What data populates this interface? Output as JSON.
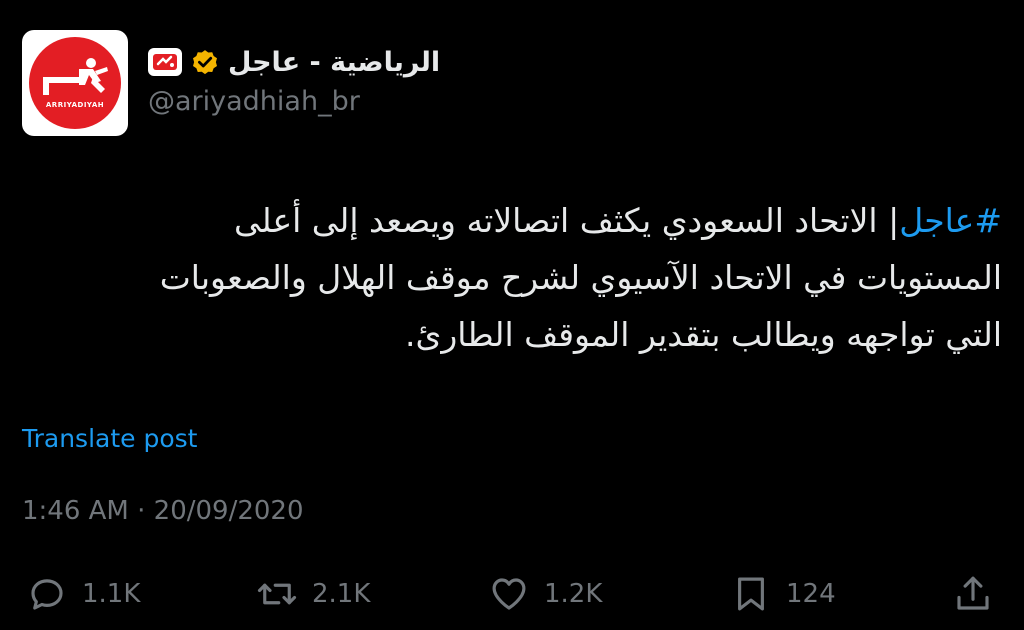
{
  "author": {
    "display_name": "الرياضية - عاجل",
    "handle": "@ariyadhiah_br",
    "avatar_logo_text": "ARRIYADIYAH",
    "affiliate_badge_text": "ر",
    "verified": true,
    "brand_color": "#e31e24",
    "verified_color": "#f4b400"
  },
  "tweet": {
    "hashtag": "#عاجل",
    "lines": [
      "| الاتحاد السعودي يكثف اتصالاته ويصعد إلى أعلى",
      "المستويات في الاتحاد الآسيوي لشرح موقف الهلال والصعوبات",
      "التي تواجهه ويطالب بتقدير الموقف الطارئ."
    ]
  },
  "translate_label": "Translate post",
  "timestamp": "1:46 AM · 20/09/2020",
  "actions": {
    "reply": {
      "icon": "reply-icon",
      "count": "1.1K"
    },
    "retweet": {
      "icon": "retweet-icon",
      "count": "2.1K"
    },
    "like": {
      "icon": "heart-icon",
      "count": "1.2K"
    },
    "bookmark": {
      "icon": "bookmark-icon",
      "count": "124"
    },
    "share": {
      "icon": "share-icon"
    }
  },
  "colors": {
    "background": "#000000",
    "text_primary": "#e7e9ea",
    "text_secondary": "#71767b",
    "link": "#1d9bf0"
  }
}
